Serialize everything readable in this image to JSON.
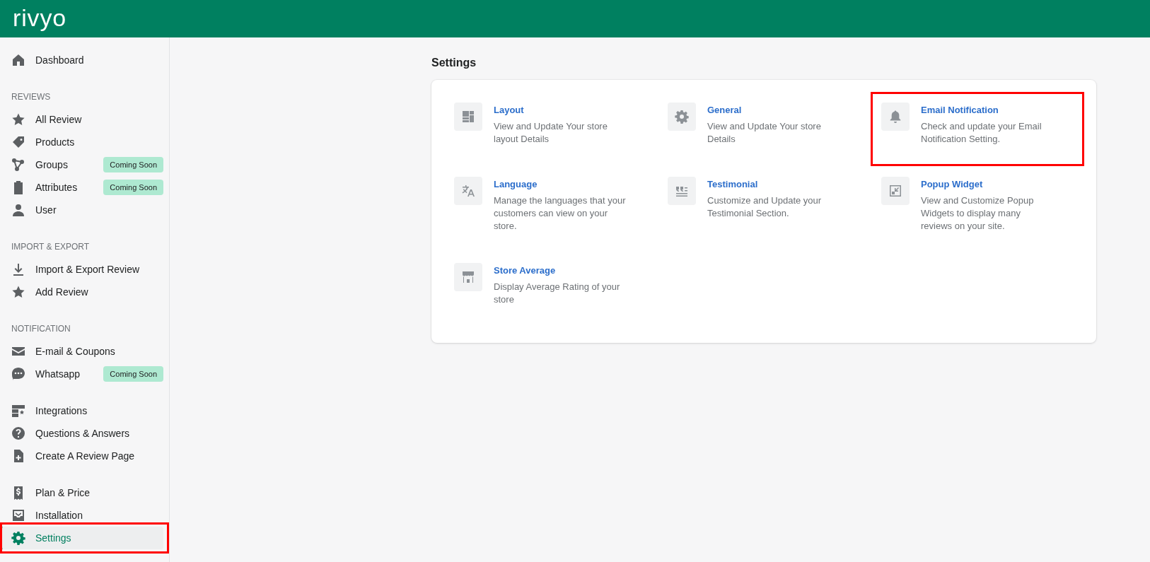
{
  "header": {
    "logo": "rivyo"
  },
  "sidebar": {
    "sections": [
      {
        "items": [
          {
            "label": "Dashboard",
            "selected": false,
            "highlighted": false
          }
        ]
      },
      {
        "heading": "REVIEWS",
        "items": [
          {
            "label": "All Review",
            "selected": false,
            "highlighted": false
          },
          {
            "label": "Products",
            "selected": false,
            "highlighted": false
          },
          {
            "label": "Groups",
            "badge": "Coming Soon",
            "selected": false,
            "highlighted": false
          },
          {
            "label": "Attributes",
            "badge": "Coming Soon",
            "selected": false,
            "highlighted": false
          },
          {
            "label": "User",
            "selected": false,
            "highlighted": false
          }
        ]
      },
      {
        "heading": "IMPORT & EXPORT",
        "items": [
          {
            "label": "Import & Export Review",
            "selected": false,
            "highlighted": false
          },
          {
            "label": "Add Review",
            "selected": false,
            "highlighted": false
          }
        ]
      },
      {
        "heading": "NOTIFICATION",
        "items": [
          {
            "label": "E-mail & Coupons",
            "selected": false,
            "highlighted": false
          },
          {
            "label": "Whatsapp",
            "badge": "Coming Soon",
            "selected": false,
            "highlighted": false
          }
        ]
      },
      {
        "items": [
          {
            "label": "Integrations",
            "selected": false,
            "highlighted": false
          },
          {
            "label": "Questions & Answers",
            "selected": false,
            "highlighted": false
          },
          {
            "label": "Create A Review Page",
            "selected": false,
            "highlighted": false
          }
        ]
      },
      {
        "items": [
          {
            "label": "Plan & Price",
            "selected": false,
            "highlighted": false
          },
          {
            "label": "Installation",
            "selected": false,
            "highlighted": false
          },
          {
            "label": "Settings",
            "selected": true,
            "highlighted": true
          }
        ]
      }
    ]
  },
  "page": {
    "title": "Settings",
    "options": [
      {
        "title": "Layout",
        "description": "View and Update Your store layout Details",
        "highlighted": false
      },
      {
        "title": "General",
        "description": "View and Update Your store Details",
        "highlighted": false
      },
      {
        "title": "Email Notification",
        "description": "Check and update your Email Notification Setting.",
        "highlighted": true
      },
      {
        "title": "Language",
        "description": "Manage the languages that your customers can view on your store.",
        "highlighted": false
      },
      {
        "title": "Testimonial",
        "description": "Customize and Update your Testimonial Section.",
        "highlighted": false
      },
      {
        "title": "Popup Widget",
        "description": "View and Customize Popup Widgets to display many reviews on your site.",
        "highlighted": false
      },
      {
        "title": "Store Average",
        "description": "Display Average Rating of your store",
        "highlighted": false
      }
    ]
  }
}
